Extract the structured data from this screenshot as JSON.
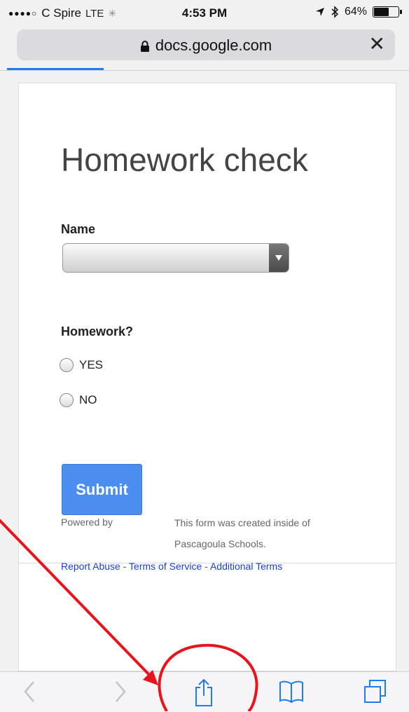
{
  "status_bar": {
    "carrier": "C Spire",
    "network": "LTE",
    "time": "4:53 PM",
    "battery": "64%",
    "battery_level": 0.64
  },
  "address_bar": {
    "url": "docs.google.com"
  },
  "form": {
    "title": "Homework check",
    "name_label": "Name",
    "homework_label": "Homework?",
    "options": [
      "YES",
      "NO"
    ],
    "submit_label": "Submit"
  },
  "footer": {
    "powered_by": "Powered by",
    "created_line": "This form was created inside of Pascagoula Schools.",
    "report_abuse": "Report Abuse",
    "sep1": " - ",
    "terms": "Terms of Service",
    "sep2": " - ",
    "additional": "Additional Terms"
  },
  "toolbar": {
    "icons": [
      "back-icon",
      "forward-icon",
      "share-icon",
      "bookmarks-icon",
      "tabs-icon"
    ]
  },
  "colors": {
    "accent": "#1e7cf0",
    "submit": "#4b8ef0",
    "link": "#1a3fd0",
    "annotation": "#e8131b"
  }
}
